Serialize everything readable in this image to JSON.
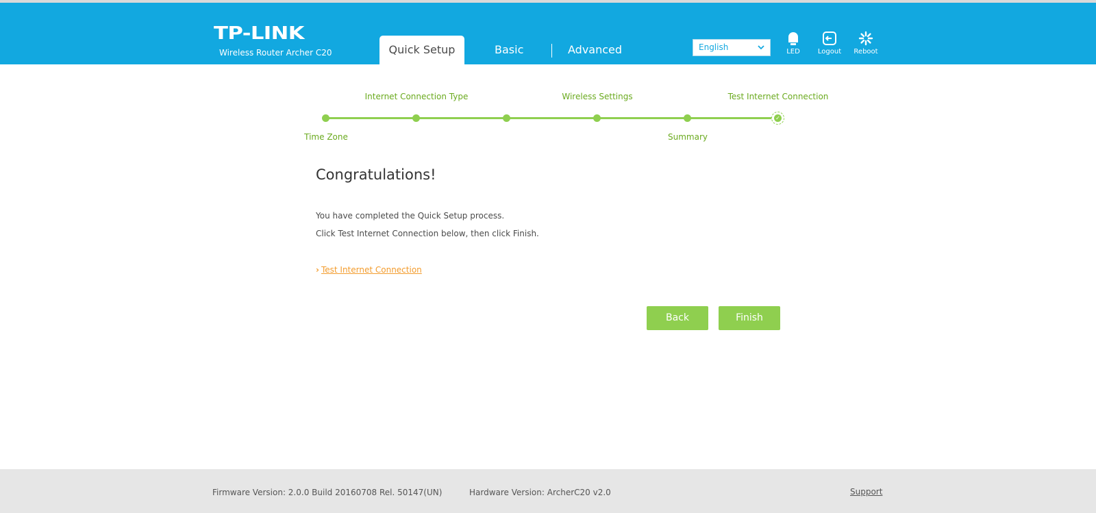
{
  "header": {
    "logo": "TP-LINK",
    "model": "Wireless Router Archer C20",
    "tabs": [
      {
        "label": "Quick Setup"
      },
      {
        "label": "Basic"
      },
      {
        "label": "Advanced"
      }
    ],
    "language": "English",
    "buttons": {
      "led": "LED",
      "logout": "Logout",
      "reboot": "Reboot"
    }
  },
  "progress": {
    "steps_top": [
      "Internet Connection Type",
      "Wireless Settings",
      "Test Internet Connection"
    ],
    "steps_bottom": [
      "Time Zone",
      "Summary"
    ]
  },
  "content": {
    "title": "Congratulations!",
    "line1": "You have completed the Quick Setup process.",
    "line2": "Click Test Internet Connection below, then click Finish.",
    "test_link": "Test Internet Connection",
    "back": "Back",
    "finish": "Finish"
  },
  "footer": {
    "firmware": "Firmware Version: 2.0.0 Build 20160708 Rel. 50147(UN)",
    "hardware": "Hardware Version: ArcherC20 v2.0",
    "support": "Support"
  },
  "colors": {
    "header_bg": "#12a8e0",
    "accent_green": "#8fcf4f",
    "link_orange": "#f39c2d"
  }
}
